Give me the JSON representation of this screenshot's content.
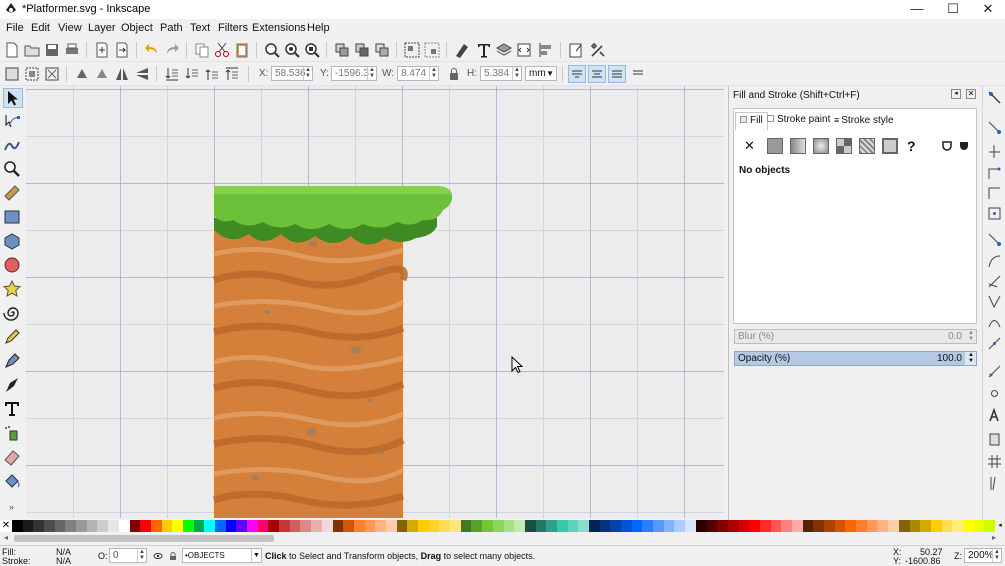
{
  "window": {
    "title": "*Platformer.svg - Inkscape",
    "minimize": "—",
    "maximize": "☐",
    "close": "✕"
  },
  "menu": [
    "File",
    "Edit",
    "View",
    "Layer",
    "Object",
    "Path",
    "Text",
    "Filters",
    "Extensions",
    "Help"
  ],
  "controls": {
    "x_label": "X:",
    "x_value": "58.536",
    "y_label": "Y:",
    "y_value": "-1596.3",
    "w_label": "W:",
    "w_value": "8.474",
    "lock_icon": "lock-icon",
    "h_label": "H:",
    "h_value": "5.384",
    "unit": "mm"
  },
  "panel": {
    "title": "Fill and Stroke (Shift+Ctrl+F)",
    "tabs": [
      "Fill",
      "Stroke paint",
      "Stroke style"
    ],
    "no_objects": "No objects",
    "blur_label": "Blur (%)",
    "blur_value": "0.0",
    "opacity_label": "Opacity (%)",
    "opacity_value": "100.0",
    "unset_glyph": "✕",
    "unknown_glyph": "?"
  },
  "status": {
    "fill_label": "Fill:",
    "fill_value": "N/A",
    "stroke_label": "Stroke:",
    "stroke_value": "N/A",
    "opacity_label": "O:",
    "opacity_value": "0",
    "layer": "•OBJECTS",
    "message_click": "Click",
    "message_mid1": " to Select and Transform objects, ",
    "message_drag": "Drag",
    "message_mid2": " to select many objects.",
    "cursor_x_label": "X:",
    "cursor_x": "50.27",
    "cursor_y_label": "Y:",
    "cursor_y": "-1600.86",
    "zoom_label": "Z:",
    "zoom_value": "200%"
  },
  "colors": {
    "accent": "#cfe3f7",
    "grass_light": "#6cc13a",
    "grass_dark": "#3f8a22",
    "dirt": "#d4803a",
    "dirt_dark": "#b9692a"
  },
  "palette": [
    "#000000",
    "#1a1a1a",
    "#333333",
    "#4d4d4d",
    "#666666",
    "#808080",
    "#999999",
    "#b3b3b3",
    "#cccccc",
    "#e6e6e6",
    "#ffffff",
    "#800000",
    "#ff0000",
    "#ff6600",
    "#ffcc00",
    "#ffff00",
    "#00ff00",
    "#00aa44",
    "#00ffff",
    "#0066ff",
    "#0000ff",
    "#6600ff",
    "#ff00ff",
    "#ff0066",
    "#aa0000",
    "#c83737",
    "#d35f5f",
    "#de8787",
    "#e9afaf",
    "#f4d7d7",
    "#803300",
    "#d45500",
    "#ff7f2a",
    "#ff9955",
    "#ffb380",
    "#ffccaa",
    "#806600",
    "#d4aa00",
    "#ffcc00",
    "#ffd42a",
    "#ffdd55",
    "#ffe680",
    "#447821",
    "#5aa02c",
    "#71c837",
    "#8dd35f",
    "#aade87",
    "#c6e9af",
    "#165044",
    "#217867",
    "#2ca089",
    "#37c8ab",
    "#5fd3bc",
    "#87decd",
    "#002255",
    "#003380",
    "#0044aa",
    "#0055d4",
    "#0066ff",
    "#2a7fff",
    "#5599ff",
    "#80b3ff",
    "#aaccff",
    "#d5e5ff",
    "#2b0000",
    "#550000",
    "#800000",
    "#aa0000",
    "#d40000",
    "#ff0000",
    "#ff2a2a",
    "#ff5555",
    "#ff8080",
    "#ffaaaa",
    "#552200",
    "#803300",
    "#aa4400",
    "#d45500",
    "#ff6600",
    "#ff7f2a",
    "#ff9955",
    "#ffb380",
    "#ffccaa",
    "#806600",
    "#aa8800",
    "#d4aa00",
    "#ffcc00",
    "#ffdd55",
    "#ffee77",
    "#ffff00",
    "#eeff00",
    "#ccff00"
  ]
}
